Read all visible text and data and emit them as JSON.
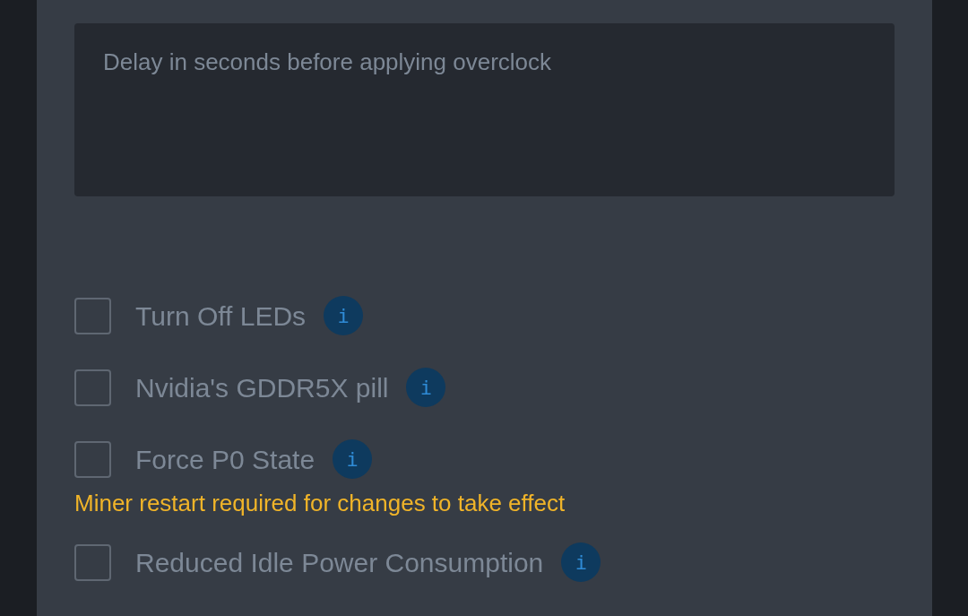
{
  "delay_field": {
    "placeholder": "Delay in seconds before applying overclock"
  },
  "options": [
    {
      "kind": "checkbox",
      "label": "Turn Off LEDs",
      "checked": false,
      "info": "i"
    },
    {
      "kind": "checkbox",
      "label": "Nvidia's GDDR5X pill",
      "checked": false,
      "info": "i"
    },
    {
      "kind": "checkbox",
      "label": "Force P0 State",
      "checked": false,
      "info": "i"
    },
    {
      "kind": "notice",
      "text": "Miner restart required for changes to take effect"
    },
    {
      "kind": "checkbox",
      "label": "Reduced Idle Power Consumption",
      "checked": false,
      "info": "i"
    }
  ]
}
